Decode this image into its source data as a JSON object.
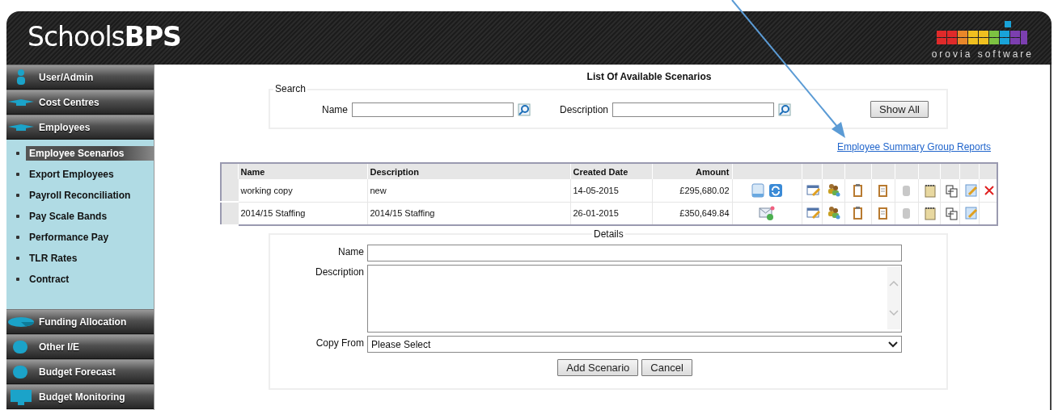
{
  "header": {
    "logo": "Schools**BPS**",
    "vendor": "orovia software"
  },
  "sidebar": {
    "sections": [
      {
        "label": "User/Admin"
      },
      {
        "label": "Cost Centres"
      },
      {
        "label": "Employees",
        "children": [
          {
            "label": "Employee Scenarios",
            "selected": true
          },
          {
            "label": "Export Employees",
            "selected": false
          },
          {
            "label": "Payroll Reconciliation",
            "selected": false
          },
          {
            "label": "Pay Scale Bands",
            "selected": false
          },
          {
            "label": "Performance Pay",
            "selected": false
          },
          {
            "label": "TLR Rates",
            "selected": false
          },
          {
            "label": "Contract",
            "selected": false
          }
        ]
      },
      {
        "label": "Funding Allocation"
      },
      {
        "label": "Other I/E"
      },
      {
        "label": "Budget Forecast"
      },
      {
        "label": "Budget Monitoring"
      }
    ]
  },
  "page_title": "List Of Available Scenarios",
  "search": {
    "legend": "Search",
    "fields": [
      {
        "label": "Name"
      },
      {
        "label": "Description"
      }
    ],
    "button": "Show All"
  },
  "report_link": "Employee Summary Group Reports",
  "table": {
    "columns": [
      "Name",
      "Description",
      "Created Date",
      "Amount"
    ],
    "rows": [
      {
        "name": "working copy",
        "description": "new",
        "created": "14-05-2015",
        "amount": "£295,680.02",
        "kind": "document",
        "deletable": true
      },
      {
        "name": "2014/15 Staffing",
        "description": "2014/15 Staffing",
        "created": "26-01-2015",
        "amount": "£350,649.84",
        "kind": "mail",
        "deletable": false
      }
    ]
  },
  "details": {
    "legend": "Details",
    "name_label": "Name",
    "description_label": "Description",
    "copy_label": "Copy From",
    "copy_value": "Please Select",
    "buttons": [
      "Add Scenario",
      "Cancel"
    ]
  }
}
